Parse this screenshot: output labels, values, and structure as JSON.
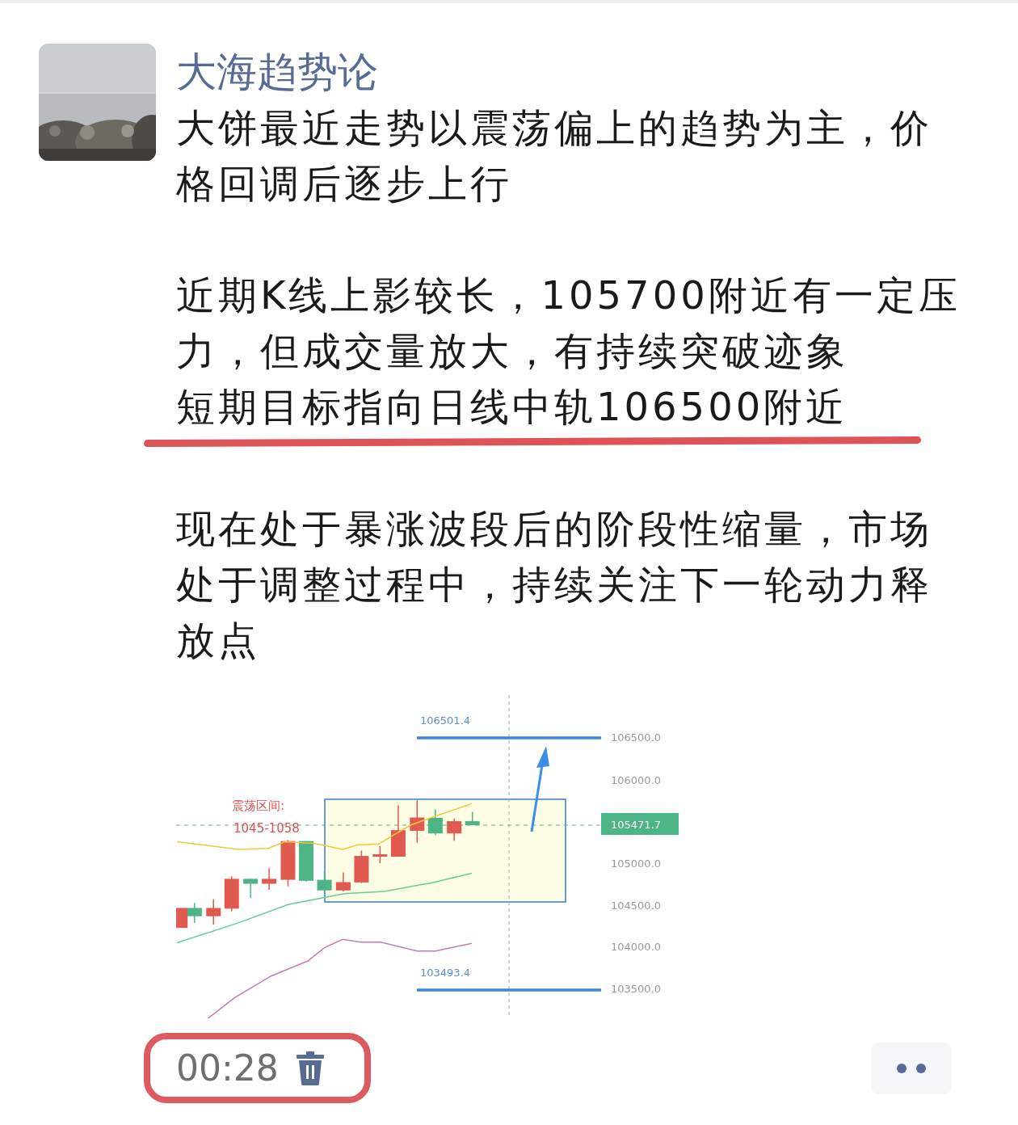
{
  "author": {
    "name": "大海趋势论"
  },
  "paragraphs": [
    {
      "text": "大饼最近走势以震荡偏上的趋势为主，价格回调后逐步上行"
    },
    {
      "text": "近期K线上影较长，105700附近有一定压力，但成交量放大，有持续突破迹象",
      "underlined_line": "短期目标指向日线中轨106500附近"
    },
    {
      "text": "现在处于暴涨波段后的阶段性缩量，市场处于调整过程中，持续关注下一轮动力释放点"
    }
  ],
  "chart_image": {
    "axis_labels": [
      "106500.0",
      "106000.0",
      "105000.0",
      "104500.0",
      "104000.0",
      "103500.0"
    ],
    "current_price": "105471.7",
    "upper_target": "106501.4",
    "lower_target": "103493.4",
    "range_label": "震荡区间:",
    "range_values": "1045-1058"
  },
  "footer": {
    "duration": "00:28"
  }
}
